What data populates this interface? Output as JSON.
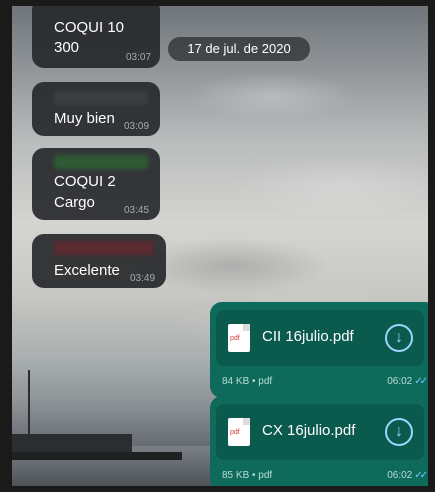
{
  "date_chip": "17 de jul. de 2020",
  "messages_in": [
    {
      "line1": "COQUI 10",
      "line2": "300",
      "time": "03:07"
    },
    {
      "line1": "Muy bien",
      "time": "03:09"
    },
    {
      "line1": "COQUI 2",
      "line2": "Cargo",
      "time": "03:45"
    },
    {
      "line1": "Excelente",
      "time": "03:49"
    }
  ],
  "files_out": [
    {
      "name": "CII 16julio.pdf",
      "meta": "84 KB • pdf",
      "time": "06:02",
      "icon_label": "pdf",
      "action_icon": "download-icon",
      "status_icon": "double-check-icon"
    },
    {
      "name": "CX 16julio.pdf",
      "meta": "85 KB • pdf",
      "time": "06:02",
      "icon_label": "pdf",
      "action_icon": "download-icon",
      "status_icon": "double-check-icon"
    }
  ],
  "colors": {
    "incoming_bubble": "#28292d",
    "outgoing_bubble": "#0e6b5c",
    "download_accent": "#9ed4ff",
    "read_ticks": "#7cc2ff"
  }
}
